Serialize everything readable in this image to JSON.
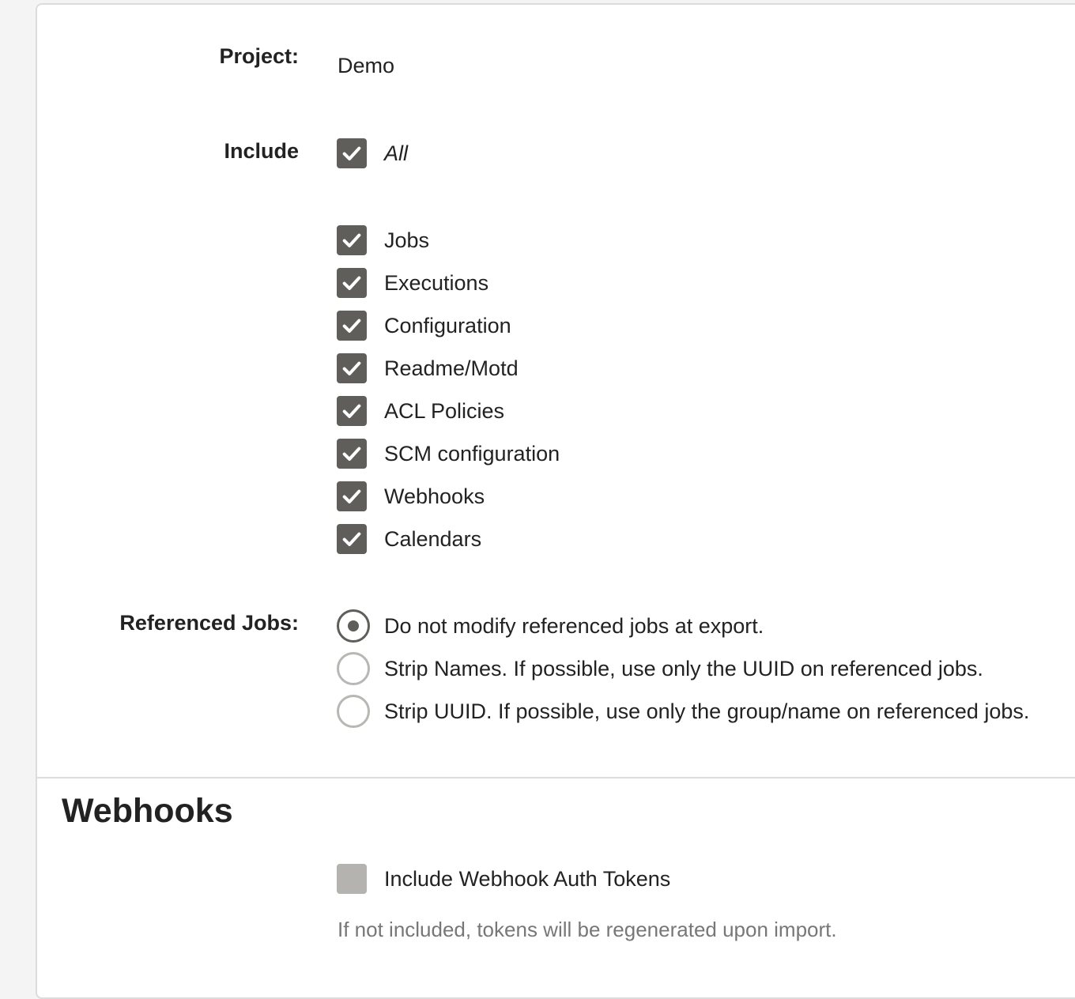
{
  "form": {
    "project_label": "Project:",
    "project_value": "Demo",
    "include_label": "Include",
    "include_all_label": "All",
    "include_items": [
      {
        "label": "Jobs",
        "checked": true
      },
      {
        "label": "Executions",
        "checked": true
      },
      {
        "label": "Configuration",
        "checked": true
      },
      {
        "label": "Readme/Motd",
        "checked": true
      },
      {
        "label": "ACL Policies",
        "checked": true
      },
      {
        "label": "SCM configuration",
        "checked": true
      },
      {
        "label": "Webhooks",
        "checked": true
      },
      {
        "label": "Calendars",
        "checked": true
      }
    ],
    "referenced_jobs_label": "Referenced Jobs:",
    "referenced_jobs_options": [
      {
        "label": "Do not modify referenced jobs at export.",
        "selected": true
      },
      {
        "label": "Strip Names. If possible, use only the UUID on referenced jobs.",
        "selected": false
      },
      {
        "label": "Strip UUID. If possible, use only the group/name on referenced jobs.",
        "selected": false
      }
    ]
  },
  "webhooks_section": {
    "title": "Webhooks",
    "include_tokens_label": "Include Webhook Auth Tokens",
    "include_tokens_checked": false,
    "help_text": "If not included, tokens will be regenerated upon import."
  },
  "colors": {
    "checkbox_checked": "#5f5e5a",
    "checkbox_unchecked": "#b5b3b0",
    "radio_border": "#b9b7b4",
    "help_text": "#777777"
  },
  "icons": {
    "checkmark": "check-icon"
  }
}
